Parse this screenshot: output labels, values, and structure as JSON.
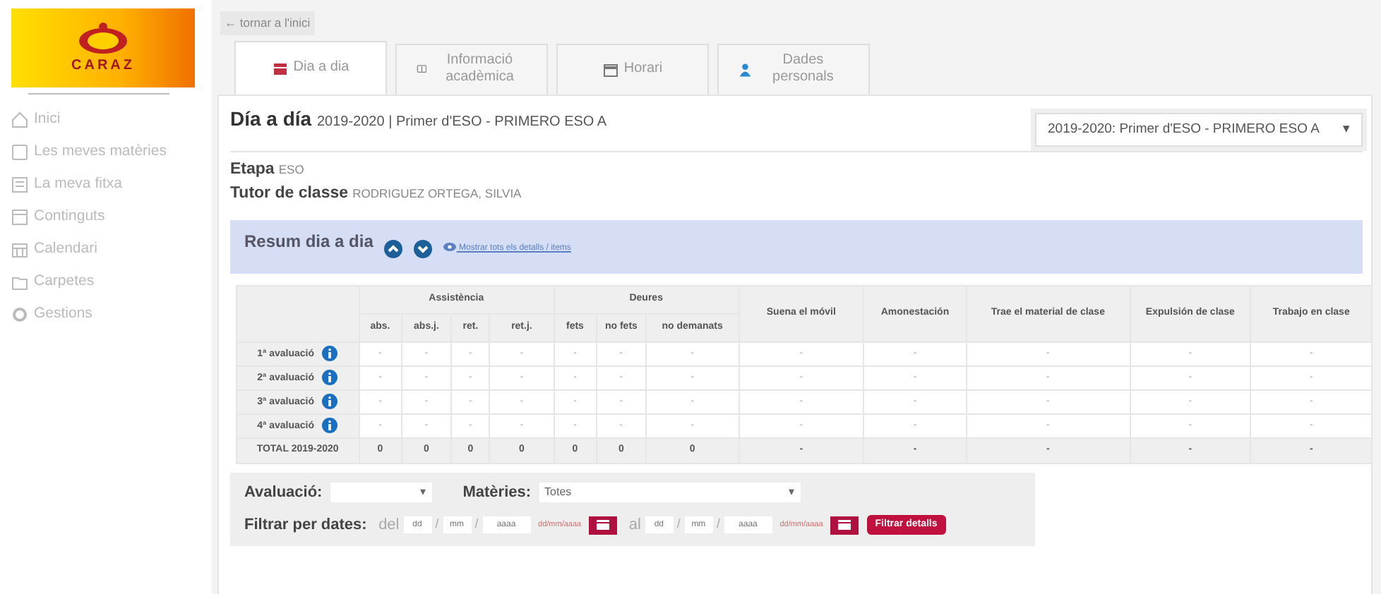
{
  "sidebar": {
    "logo_text": "CARAZ",
    "items": [
      {
        "label": "Inici"
      },
      {
        "label": "Les meves matèries"
      },
      {
        "label": "La meva fitxa"
      },
      {
        "label": "Continguts"
      },
      {
        "label": "Calendari"
      },
      {
        "label": "Carpetes"
      },
      {
        "label": "Gestions"
      }
    ]
  },
  "back_link": "← tornar a l'inici",
  "tabs": [
    {
      "label": "Dia a dia",
      "selected": true
    },
    {
      "label": "Informació acadèmica",
      "selected": false
    },
    {
      "label": "Horari",
      "selected": false
    },
    {
      "label": "Dades personals",
      "selected": false
    }
  ],
  "heading": {
    "title": "Día a día",
    "subtitle": "2019-2020 | Primer d'ESO - PRIMERO ESO A"
  },
  "course_select": {
    "value": "2019-2020: Primer d'ESO - PRIMERO ESO A",
    "caret": "▾"
  },
  "info": [
    {
      "label": "Etapa",
      "value": "ESO"
    },
    {
      "label": "Tutor de classe",
      "value": "RODRIGUEZ ORTEGA, SILVIA"
    }
  ],
  "summary_bar": {
    "title": "Resum dia a dia",
    "link": "Mostrar tots els detalls / items"
  },
  "table": {
    "groups": [
      {
        "label": "Assistència",
        "columns": [
          "abs.",
          "abs.j.",
          "ret.",
          "ret.j."
        ]
      },
      {
        "label": "Deures",
        "columns": [
          "fets",
          "no fets",
          "no demanats"
        ]
      }
    ],
    "single_columns": [
      "Suena el móvil",
      "Amonestación",
      "Trae el material de clase",
      "Expulsión de clase",
      "Trabajo en clase"
    ],
    "rows": [
      {
        "kind": "period",
        "label": "1ª avaluació",
        "cells": [
          "-",
          "-",
          "-",
          "-",
          "-",
          "-",
          "-",
          "-",
          "-",
          "-",
          "-",
          "-"
        ]
      },
      {
        "kind": "period",
        "label": "2ª avaluació",
        "cells": [
          "-",
          "-",
          "-",
          "-",
          "-",
          "-",
          "-",
          "-",
          "-",
          "-",
          "-",
          "-"
        ]
      },
      {
        "kind": "period",
        "label": "3ª avaluació",
        "cells": [
          "-",
          "-",
          "-",
          "-",
          "-",
          "-",
          "-",
          "-",
          "-",
          "-",
          "-",
          "-"
        ]
      },
      {
        "kind": "period",
        "label": "4ª avaluació",
        "cells": [
          "-",
          "-",
          "-",
          "-",
          "-",
          "-",
          "-",
          "-",
          "-",
          "-",
          "-",
          "-"
        ]
      },
      {
        "kind": "total",
        "label": "TOTAL 2019-2020",
        "cells": [
          "0",
          "0",
          "0",
          "0",
          "0",
          "0",
          "0",
          "-",
          "-",
          "-",
          "-",
          "-"
        ]
      }
    ]
  },
  "filters": {
    "evaluation_label": "Avaluació:",
    "evaluation_caret": "▾",
    "subjects_label": "Matèries:",
    "subjects_value": "Totes",
    "subjects_caret": "▾",
    "dates_label": "Filtrar per dates:",
    "ranges": [
      {
        "word": "del",
        "fields": [
          {
            "placeholder": "dd"
          },
          {
            "placeholder": "mm"
          },
          {
            "placeholder": "aaaa"
          }
        ],
        "sep": "/",
        "hint": "dd/mm/aaaa"
      },
      {
        "word": "al",
        "fields": [
          {
            "placeholder": "dd"
          },
          {
            "placeholder": "mm"
          },
          {
            "placeholder": "aaaa"
          }
        ],
        "sep": "/",
        "hint": "dd/mm/aaaa"
      }
    ],
    "button": "Filtrar detalls"
  }
}
